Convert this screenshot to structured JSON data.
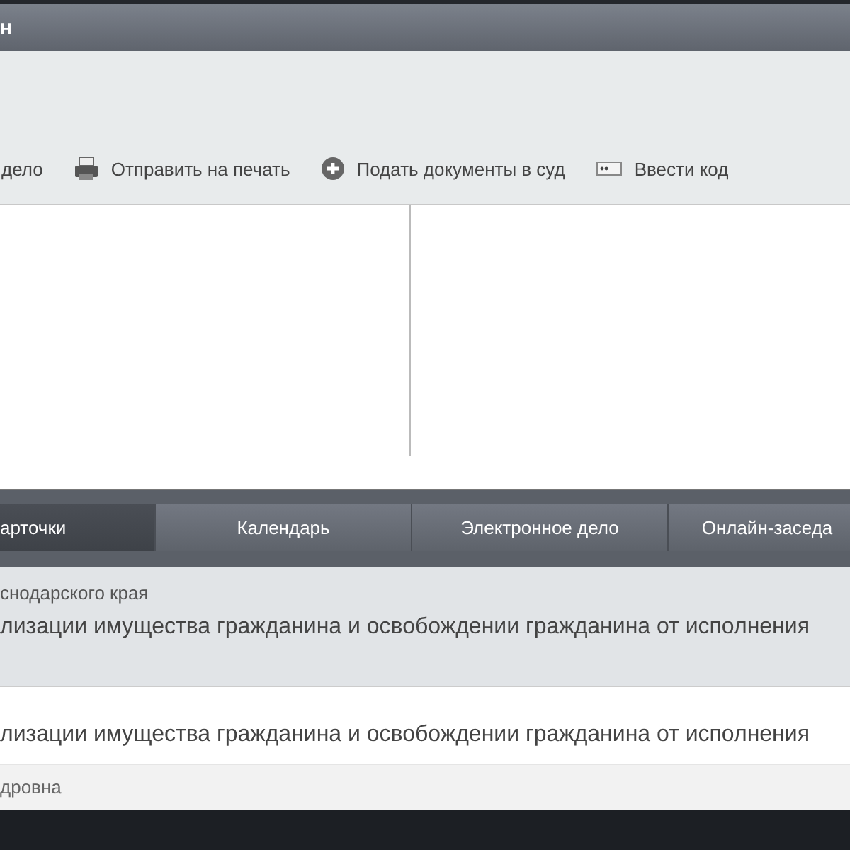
{
  "header": {
    "title": "н"
  },
  "toolbar": [
    {
      "kind": "text",
      "label": "дело"
    },
    {
      "kind": "printer",
      "label": "Отправить на печать"
    },
    {
      "kind": "plus",
      "label": "Подать документы в суд"
    },
    {
      "kind": "code",
      "label": "Ввести код"
    }
  ],
  "tabs": [
    {
      "label": "арточки",
      "selected": true
    },
    {
      "label": "Календарь",
      "selected": false
    },
    {
      "label": "Электронное дело",
      "selected": false
    },
    {
      "label": "Онлайн-заседа",
      "selected": false
    }
  ],
  "card": {
    "court": "снодарского края",
    "title": "лизации имущества гражданина и освобождении гражданина от исполнения"
  },
  "row": {
    "title": "лизации имущества гражданина и освобождении гражданина от исполнения",
    "person": "дровна"
  }
}
